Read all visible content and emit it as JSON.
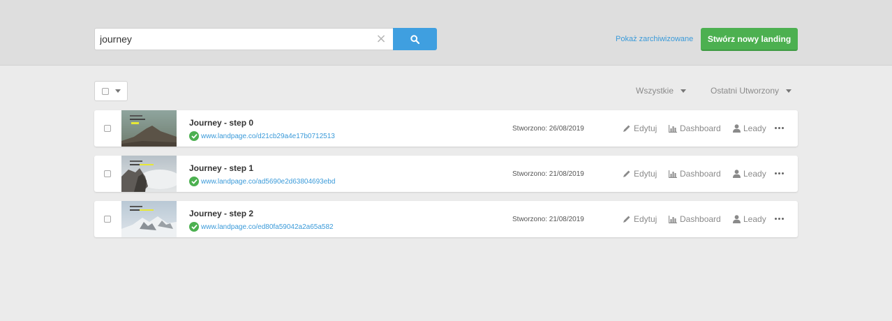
{
  "search": {
    "value": "journey",
    "clear_glyph": "×"
  },
  "header": {
    "archive_link": "Pokaż zarchiwizowane",
    "create_button": "Stwórz nowy landing"
  },
  "filters": {
    "status": "Wszystkie",
    "sort": "Ostatni Utworzony"
  },
  "actions": {
    "edit": "Edytuj",
    "dashboard": "Dashboard",
    "leads": "Leady"
  },
  "landings": [
    {
      "title": "Journey - step 0",
      "url": "www.landpage.co/d21cb29a4e17b0712513",
      "created": "Stworzono: 26/08/2019",
      "thumb_top": "#8da39c",
      "thumb_bottom": "#5b5347"
    },
    {
      "title": "Journey - step 1",
      "url": "www.landpage.co/ad5690e2d63804693ebd",
      "created": "Stworzono: 21/08/2019",
      "thumb_top": "#c9ced2",
      "thumb_bottom": "#6d6a66"
    },
    {
      "title": "Journey - step 2",
      "url": "www.landpage.co/ed80fa59042a2a65a582",
      "created": "Stworzono: 21/08/2019",
      "thumb_top": "#c5d2dd",
      "thumb_bottom": "#e7ebee"
    }
  ],
  "colors": {
    "accent_blue": "#3f9fe0",
    "accent_green": "#4cb050",
    "link": "#3a9ad9"
  }
}
